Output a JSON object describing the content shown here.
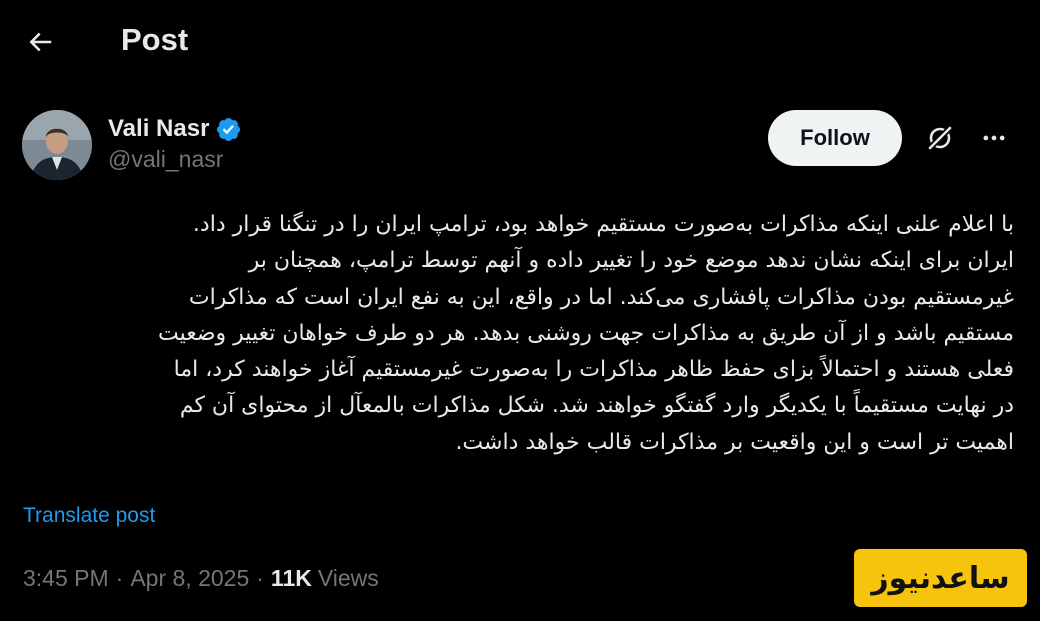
{
  "header": {
    "title": "Post",
    "back_icon": "arrow-left-icon"
  },
  "author": {
    "name": "Vali Nasr",
    "handle": "@vali_nasr",
    "verified_icon": "verified-badge-icon",
    "verified_color": "#1d9bf0"
  },
  "actions": {
    "follow_label": "Follow",
    "grok_icon": "grok-icon",
    "more_icon": "more-horizontal-icon"
  },
  "post": {
    "lines": [
      "با اعلام علنی اینکه مذاکرات به‌صورت مستقیم خواهد بود، ترامپ ایران را در تنگنا قرار داد.",
      "ایران برای اینکه نشان ندهد موضع خود را تغییر داده و آنهم توسط ترامپ، همچنان بر",
      "غیرمستقیم بودن مذاکرات پافشاری می‌کند. اما در واقع، این به نفع ایران است که مذاکرات",
      "مستقیم باشد و از آن طریق به مذاکرات جهت روشنی بدهد. هر دو طرف خواهان تغییر وضعیت",
      "فعلی هستند و احتمالاً بزای حفظ ظاهر مذاکرات را به‌صورت غیرمستقیم آغاز خواهند کرد، اما",
      "در نهایت مستقیماً با یکدیگر وارد گفتگو خواهند شد. شکل مذاکرات بالمعآل از محتوای آن کم",
      "اهمیت تر است و این واقعیت بر مذاکرات قالب خواهد داشت."
    ],
    "translate_label": "Translate post"
  },
  "meta": {
    "time": "3:45 PM",
    "separator": "·",
    "date": "Apr 8, 2025",
    "views_count": "11K",
    "views_label": "Views"
  },
  "watermark": {
    "text": "ساعدنیوز",
    "color": "#f6c40c"
  },
  "colors": {
    "background": "#000000",
    "text_primary": "#e7e9ea",
    "text_secondary": "#71767b",
    "link": "#1d9bf0",
    "follow_bg": "#eff3f4"
  }
}
